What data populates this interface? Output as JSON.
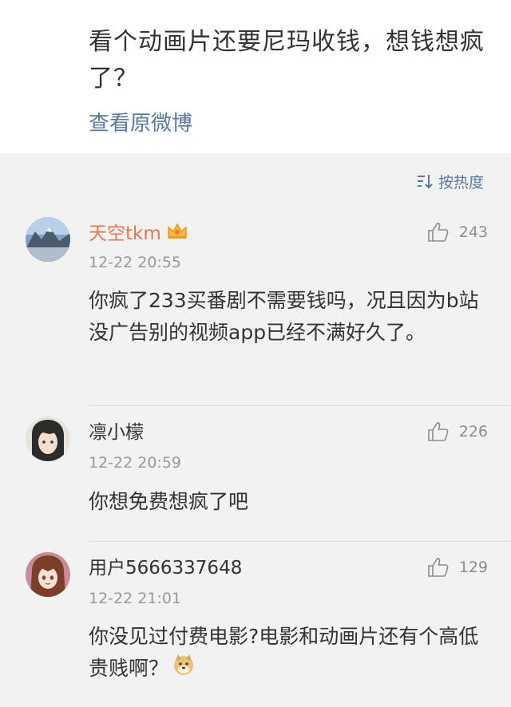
{
  "original_post": {
    "text": "看个动画片还要尼玛收钱，想钱想疯了？",
    "view_link": "查看原微博"
  },
  "sort": {
    "label": "按热度",
    "icon": "sort-icon"
  },
  "comments": [
    {
      "username": "天空tkm",
      "vip": true,
      "badge_icon": "crown-icon",
      "time": "12-22 20:55",
      "likes": "243",
      "text": "你疯了233买番剧不需要钱吗，况且因为b站没广告别的视频app已经不满好久了。"
    },
    {
      "username": "凛小檬",
      "vip": false,
      "time": "12-22 20:59",
      "likes": "226",
      "text": "你想免费想疯了吧"
    },
    {
      "username": "用户5666337648",
      "vip": false,
      "time": "12-22 21:01",
      "likes": "129",
      "text": "你没见过付费电影?电影和动画片还有个高低贵贱啊？",
      "emoji": "doge-emoji"
    }
  ],
  "colors": {
    "link": "#5a7aa3",
    "vip_name": "#eb7350",
    "text": "#333333",
    "meta": "#999999",
    "background": "#f2f2f2"
  }
}
